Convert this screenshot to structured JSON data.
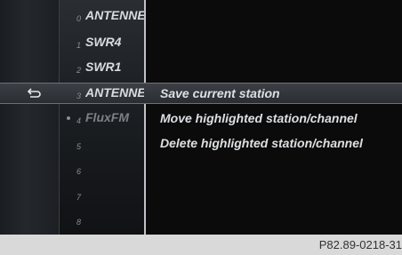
{
  "stations": [
    {
      "num": "0",
      "name": "ANTENNE",
      "dim": false,
      "dot": false
    },
    {
      "num": "1",
      "name": "SWR4",
      "dim": false,
      "dot": false
    },
    {
      "num": "2",
      "name": "SWR1",
      "dim": false,
      "dot": false
    },
    {
      "num": "3",
      "name": "ANTENNE",
      "dim": false,
      "dot": false
    },
    {
      "num": "4",
      "name": "FluxFM",
      "dim": true,
      "dot": true
    },
    {
      "num": "5",
      "name": "",
      "dim": true,
      "dot": false
    },
    {
      "num": "6",
      "name": "",
      "dim": true,
      "dot": false
    },
    {
      "num": "7",
      "name": "",
      "dim": true,
      "dot": false
    },
    {
      "num": "8",
      "name": "",
      "dim": true,
      "dot": false
    }
  ],
  "menu": {
    "items": [
      {
        "label": "Save current station"
      },
      {
        "label": "Move highlighted station/channel"
      },
      {
        "label": "Delete highlighted station/channel"
      }
    ]
  },
  "back_button": {
    "icon": "back-arrow-icon"
  },
  "footer": {
    "code": "P82.89-0218-31"
  }
}
